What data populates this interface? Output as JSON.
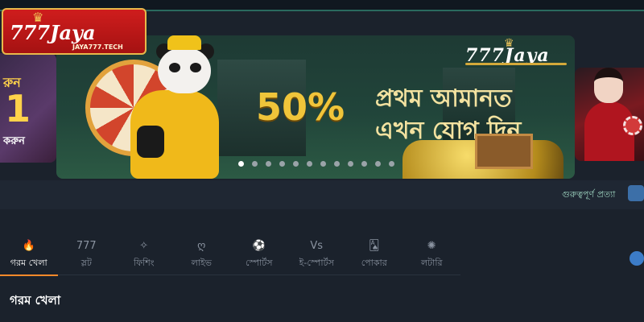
{
  "site_logo": {
    "title": "777Jaya",
    "subtitle": "JAYA777.TECH",
    "crown": "crown-icon"
  },
  "banner": {
    "logo_text": "777Jaya",
    "percent": "50%",
    "line1": "প্রথম আমানত",
    "line2": "এখন যোগ দিন",
    "slide_count": 12,
    "active_slide": 0
  },
  "left_slide": {
    "t1": "রুন",
    "t2": "1",
    "t3": "করুন"
  },
  "notice": {
    "text": "গুরুত্বপূর্ণ প্রত্যা",
    "icon": "mail-icon"
  },
  "nav": {
    "tabs": [
      {
        "label": "গরম খেলা",
        "icon": "fire-icon",
        "glyph": "🔥",
        "active": true
      },
      {
        "label": "স্লট",
        "icon": "slot-icon",
        "glyph": "777",
        "active": false
      },
      {
        "label": "ফিশিং",
        "icon": "fish-icon",
        "glyph": "✧",
        "active": false
      },
      {
        "label": "লাইভ",
        "icon": "live-icon",
        "glyph": "ღ",
        "active": false
      },
      {
        "label": "স্পোর্টস",
        "icon": "soccer-icon",
        "glyph": "⚽",
        "active": false
      },
      {
        "label": "ই-স্পোর্টস",
        "icon": "versus-icon",
        "glyph": "Vs",
        "active": false
      },
      {
        "label": "পোকার",
        "icon": "cards-icon",
        "glyph": "🂡",
        "active": false
      },
      {
        "label": "লটারি",
        "icon": "lottery-icon",
        "glyph": "✺",
        "active": false
      }
    ],
    "search_icon": "search-icon"
  },
  "section": {
    "title": "গরম খেলা"
  },
  "colors": {
    "accent": "#ff8a2a",
    "background": "#1b222c",
    "logo_red": "#cf1d1d",
    "gold": "#f0c53a"
  }
}
